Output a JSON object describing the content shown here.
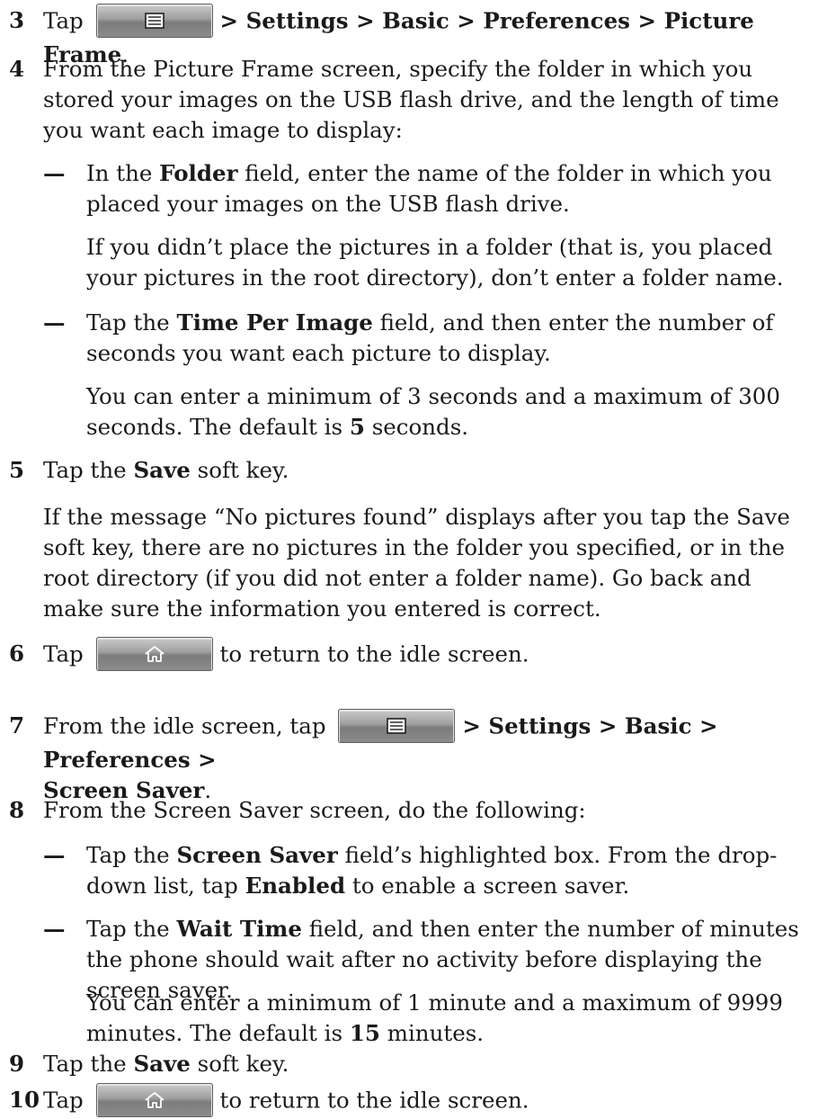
{
  "s3": {
    "num": "3",
    "pre": "Tap",
    "path1": "> Settings > Basic > Preferences > Picture Frame",
    "end": ".",
    "icon": "menu-icon"
  },
  "s4": {
    "num": "4",
    "text": "From the Picture Frame screen, specify the folder in which you stored your images on the USB flash drive, and the length of time you want each image to display:",
    "b1": {
      "pre": "In the ",
      "bold": "Folder",
      "post": " field, enter the name of the folder in which you placed your images on the USB flash drive."
    },
    "n1": "If you didn’t place the pictures in a folder (that is, you placed your pictures in the root directory), don’t enter a folder name.",
    "b2": {
      "pre": "Tap the ",
      "bold": "Time Per Image",
      "post": " field, and then enter the number of seconds you want each picture to display."
    },
    "n2": {
      "pre": "You can enter a minimum of 3 seconds and a maximum of 300 seconds. The default is ",
      "bold": "5",
      "post": " seconds."
    },
    "dash": "—"
  },
  "s5": {
    "num": "5",
    "pre": "Tap the ",
    "bold": "Save",
    "post": " soft key.",
    "note": "If the message “No pictures found” displays after you tap the Save soft key, there are no pictures in the folder you specified, or in the root directory (if you did not enter a folder name). Go back and make sure the information you entered is correct."
  },
  "s6": {
    "num": "6",
    "pre": "Tap",
    "post": "to return to the idle screen.",
    "icon": "home-icon"
  },
  "s7": {
    "num": "7",
    "pre": "From the idle screen, tap",
    "path1": "> Settings > Basic > Preferences >",
    "path2": "Screen Saver",
    "end": ".",
    "icon": "menu-icon"
  },
  "s8": {
    "num": "8",
    "text": "From the Screen Saver screen, do the following:",
    "b1": {
      "pre": "Tap the ",
      "bold": "Screen Saver",
      "mid": " field’s highlighted box. From the drop-down list, tap ",
      "bold2": "Enabled",
      "post": " to enable a screen saver."
    },
    "b2": {
      "pre": "Tap the ",
      "bold": "Wait Time",
      "post": " field, and then enter the number of minutes the phone should wait after no activity before displaying the screen saver."
    },
    "n2": {
      "pre": "You can enter a minimum of 1 minute and a maximum of 9999 minutes. The default is ",
      "bold": "15",
      "post": " minutes."
    },
    "dash": "—"
  },
  "s9": {
    "num": "9",
    "pre": "Tap the ",
    "bold": "Save",
    "post": " soft key."
  },
  "s10": {
    "num": "10",
    "pre": "Tap",
    "post": "to return to the idle screen.",
    "icon": "home-icon"
  }
}
